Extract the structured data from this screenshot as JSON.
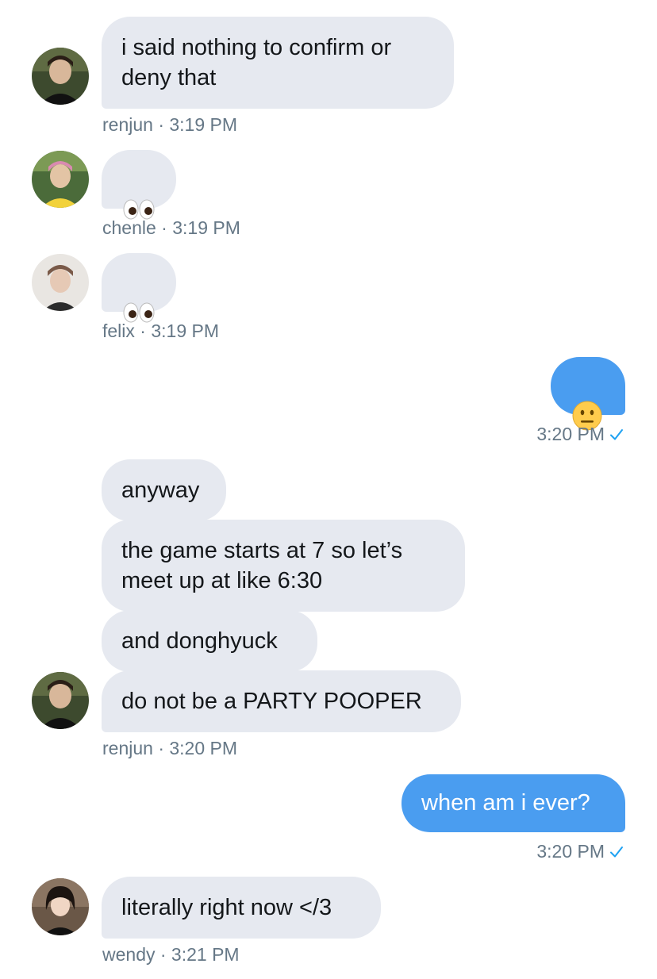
{
  "messages": [
    {
      "sender": "renjun",
      "text": "i said nothing to confirm or\ndeny that",
      "meta": "renjun · 3:19 PM"
    },
    {
      "sender": "chenle",
      "emoji": "eyes",
      "meta": "chenle · 3:19 PM"
    },
    {
      "sender": "felix",
      "emoji": "eyes",
      "meta": "felix · 3:19 PM"
    },
    {
      "sender": "me",
      "emoji": "neutral-face",
      "meta": "3:20 PM"
    },
    {
      "sender": "renjun",
      "text": "anyway"
    },
    {
      "sender": "renjun",
      "text": "the game starts at 7 so let’s\nmeet up at like 6:30"
    },
    {
      "sender": "renjun",
      "text": "and donghyuck"
    },
    {
      "sender": "renjun",
      "text": "do not be a PARTY POOPER",
      "meta": "renjun · 3:20 PM"
    },
    {
      "sender": "me",
      "text": "when am i ever?",
      "meta": "3:20 PM"
    },
    {
      "sender": "wendy",
      "text": "literally right now </3",
      "meta": "wendy · 3:21 PM"
    }
  ],
  "colors": {
    "incoming_bubble": "#e6e9f0",
    "outgoing_bubble": "#4a9df0",
    "meta_text": "#657786",
    "read_check": "#1da1f2"
  },
  "icons": [
    "avatar-renjun",
    "avatar-chenle",
    "avatar-felix",
    "avatar-wendy",
    "eyes-emoji",
    "neutral-face-emoji",
    "read-check-icon"
  ]
}
